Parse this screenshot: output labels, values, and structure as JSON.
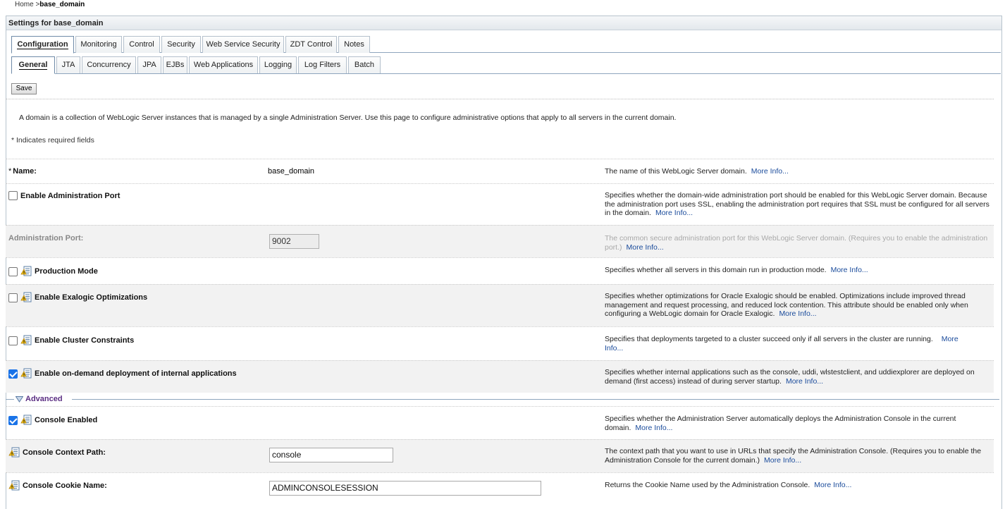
{
  "breadcrumb": {
    "home": "Home >",
    "current": "base_domain"
  },
  "panel": {
    "title": "Settings for base_domain"
  },
  "tabs_primary": [
    {
      "label": "Configuration",
      "active": true
    },
    {
      "label": "Monitoring"
    },
    {
      "label": "Control"
    },
    {
      "label": "Security"
    },
    {
      "label": "Web Service Security"
    },
    {
      "label": "ZDT Control"
    },
    {
      "label": "Notes"
    }
  ],
  "tabs_secondary": [
    {
      "label": "General",
      "active": true
    },
    {
      "label": "JTA"
    },
    {
      "label": "Concurrency"
    },
    {
      "label": "JPA"
    },
    {
      "label": "EJBs"
    },
    {
      "label": "Web Applications"
    },
    {
      "label": "Logging"
    },
    {
      "label": "Log Filters"
    },
    {
      "label": "Batch"
    }
  ],
  "toolbar": {
    "save_label": "Save"
  },
  "intro": "A domain is a collection of WebLogic Server instances that is managed by a single Administration Server. Use this page to configure administrative options that apply to all servers in the current domain.",
  "required_note": "* Indicates required fields",
  "more_info": "More Info...",
  "fields": {
    "name": {
      "label": "Name:",
      "required_mark": "*",
      "value": "base_domain",
      "desc": "The name of this WebLogic Server domain."
    },
    "enable_admin_port": {
      "label": "Enable Administration Port",
      "checked": false,
      "desc": "Specifies whether the domain-wide administration port should be enabled for this WebLogic Server domain. Because the administration port uses SSL, enabling the administration port requires that SSL must be configured for all servers in the domain."
    },
    "admin_port": {
      "label": "Administration Port:",
      "value": "9002",
      "disabled": true,
      "desc": "The common secure administration port for this WebLogic Server domain. (Requires you to enable the administration port.)"
    },
    "production_mode": {
      "label": "Production Mode",
      "checked": false,
      "desc": "Specifies whether all servers in this domain run in production mode."
    },
    "exalogic": {
      "label": "Enable Exalogic Optimizations",
      "checked": false,
      "desc": "Specifies whether optimizations for Oracle Exalogic should be enabled. Optimizations include improved thread management and request processing, and reduced lock contention. This attribute should be enabled only when configuring a WebLogic domain for Oracle Exalogic."
    },
    "cluster_constraints": {
      "label": "Enable Cluster Constraints",
      "checked": false,
      "desc": "Specifies that deployments targeted to a cluster succeed only if all servers in the cluster are running.",
      "more_a": "More",
      "more_b": "Info..."
    },
    "on_demand": {
      "label": "Enable on-demand deployment of internal applications",
      "checked": true,
      "desc": "Specifies whether internal applications such as the console, uddi, wlstestclient, and uddiexplorer are deployed on demand (first access) instead of during server startup."
    },
    "console_enabled": {
      "label": "Console Enabled",
      "checked": true,
      "desc": "Specifies whether the Administration Server automatically deploys the Administration Console in the current domain."
    },
    "console_context_path": {
      "label": "Console Context Path:",
      "value": "console",
      "desc": "The context path that you want to use in URLs that specify the Administration Console. (Requires you to enable the Administration Console for the current domain.)"
    },
    "console_cookie_name": {
      "label": "Console Cookie Name:",
      "value": "ADMINCONSOLESESSION",
      "desc": "Returns the Cookie Name used by the Administration Console."
    }
  },
  "advanced": {
    "label": "Advanced"
  },
  "colors": {
    "link": "#1a4b9b",
    "advanced": "#5a2d82",
    "tab_border": "#8ea5bd",
    "checkbox_checked": "#1a73e8"
  }
}
